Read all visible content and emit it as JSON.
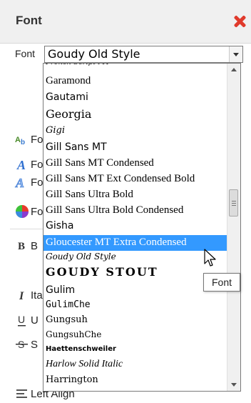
{
  "panel": {
    "title": "Font",
    "close_icon": "close-icon",
    "close_color": "#e03a2c"
  },
  "font_field": {
    "label": "Font",
    "value": "Goudy Old Style"
  },
  "background_items": [
    {
      "icon": "Ab",
      "label": "Fo",
      "icon_name": "font-size-icon"
    },
    {
      "icon": "A",
      "label": "Fo",
      "icon_name": "font-style-icon"
    },
    {
      "icon": "A",
      "label": "Fo",
      "icon_name": "font-outline-icon"
    },
    {
      "icon": "",
      "label": "Fo",
      "icon_name": "color-wheel-icon"
    },
    {
      "icon": "B",
      "label": "B",
      "icon_name": "bold-icon"
    },
    {
      "icon": "I",
      "label": "Ita",
      "icon_name": "italic-icon"
    },
    {
      "icon": "U",
      "label": "U",
      "icon_name": "underline-icon"
    },
    {
      "icon": "S",
      "label": "S",
      "icon_name": "strikethrough-icon"
    },
    {
      "icon": "≡",
      "label": "Left Align",
      "icon_name": "align-left-icon"
    }
  ],
  "font_list": [
    "French Script MT",
    "Garamond",
    "Gautami",
    "Georgia",
    "Gigi",
    "Gill Sans MT",
    "Gill Sans MT Condensed",
    "Gill Sans MT Ext Condensed Bold",
    "Gill Sans Ultra Bold",
    "Gill Sans Ultra Bold Condensed",
    "Gisha",
    "Gloucester MT Extra Condensed",
    "Goudy Old Style",
    "GOUDY STOUT",
    "Gulim",
    "GulimChe",
    "Gungsuh",
    "GungsuhChe",
    "Haettenschweiler",
    "Harlow Solid Italic",
    "Harrington"
  ],
  "highlighted_item": "Gloucester MT Extra Condensed",
  "selection_color": "#3399ff",
  "tooltip": "Font"
}
